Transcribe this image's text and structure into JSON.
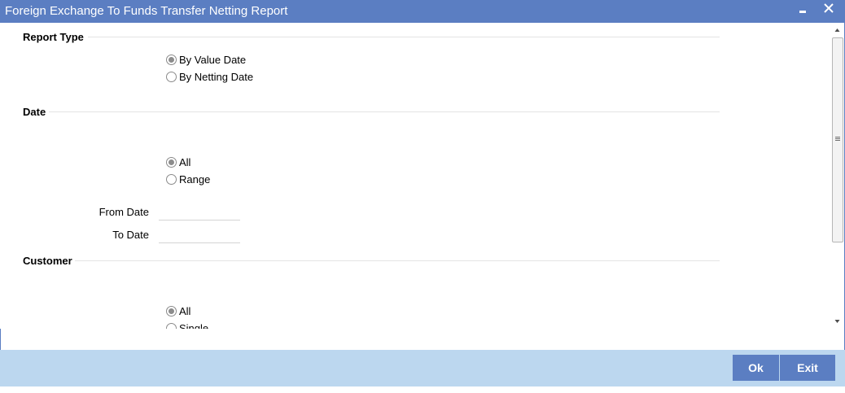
{
  "window": {
    "title": "Foreign Exchange To Funds Transfer Netting Report",
    "minimize_icon": "minimize-icon",
    "close_icon": "close-icon"
  },
  "report_type": {
    "heading": "Report Type",
    "options": [
      {
        "label": "By Value Date",
        "selected": true
      },
      {
        "label": "By Netting Date",
        "selected": false
      }
    ]
  },
  "date": {
    "heading": "Date",
    "options": [
      {
        "label": "All",
        "selected": true
      },
      {
        "label": "Range",
        "selected": false
      }
    ],
    "from_label": "From Date",
    "from_value": "",
    "to_label": "To Date",
    "to_value": ""
  },
  "customer": {
    "heading": "Customer",
    "options": [
      {
        "label": "All",
        "selected": true
      },
      {
        "label": "Single",
        "selected": false
      }
    ]
  },
  "footer": {
    "ok_label": "Ok",
    "exit_label": "Exit"
  },
  "colors": {
    "titlebar": "#5b7ec2",
    "footer": "#bcd7ef",
    "button": "#5b7ec2"
  }
}
